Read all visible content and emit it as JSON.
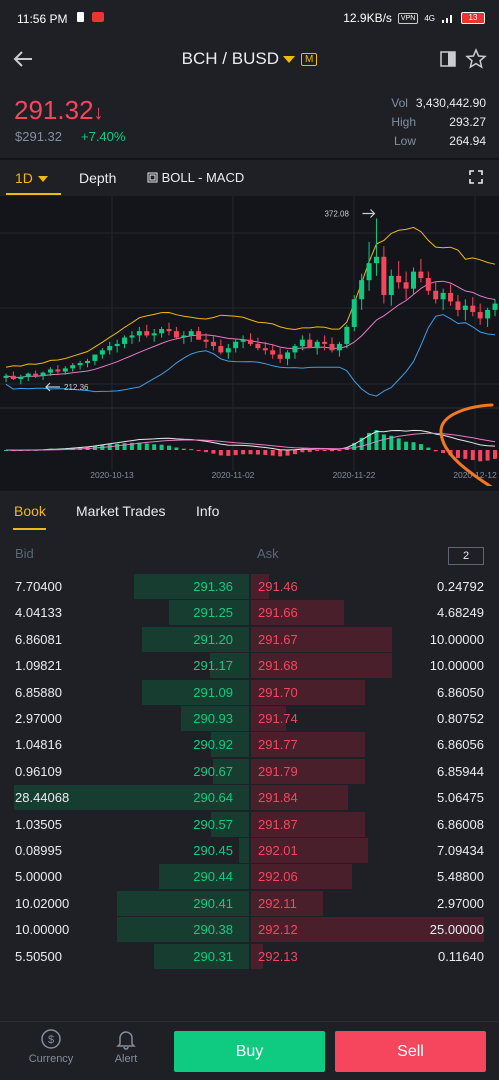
{
  "status_bar": {
    "time": "11:56 PM",
    "net_speed": "12.9KB/s",
    "vpn": "VPN",
    "network": "4G",
    "battery": "13"
  },
  "header": {
    "pair": "BCH / BUSD",
    "margin_badge": "M"
  },
  "ticker": {
    "last_price": "291.32",
    "direction_arrow": "↓",
    "usd_price": "$291.32",
    "change_pct": "+7.40%",
    "vol_label": "Vol",
    "vol": "3,430,442.90",
    "high_label": "High",
    "high": "293.27",
    "low_label": "Low",
    "low": "264.94"
  },
  "chart_tabs": {
    "interval": "1D",
    "depth": "Depth",
    "indicators": "BOLL - MACD"
  },
  "chart_data": {
    "type": "candlestick",
    "interval": "1D",
    "max_marker": "372.08",
    "min_marker": "212.36",
    "x_tick_labels": [
      "2020-10-13",
      "2020-11-02",
      "2020-11-22",
      "2020-12-12"
    ],
    "overlays": [
      "BOLL upper",
      "BOLL middle",
      "BOLL lower"
    ],
    "sub_indicator": "MACD",
    "colors": {
      "up": "#0ecb81",
      "down": "#f6465d",
      "boll_upper": "#f0b90b",
      "boll_mid": "#e879c7",
      "boll_lower": "#3d9ee8"
    },
    "ohlc": [
      [
        222,
        226,
        218,
        224
      ],
      [
        224,
        228,
        220,
        221
      ],
      [
        221,
        225,
        216,
        223
      ],
      [
        223,
        227,
        219,
        226
      ],
      [
        226,
        229,
        222,
        224
      ],
      [
        224,
        228,
        220,
        227
      ],
      [
        227,
        232,
        224,
        230
      ],
      [
        230,
        234,
        226,
        228
      ],
      [
        228,
        233,
        225,
        231
      ],
      [
        231,
        236,
        228,
        234
      ],
      [
        234,
        238,
        230,
        236
      ],
      [
        236,
        240,
        232,
        238
      ],
      [
        238,
        242,
        234,
        244
      ],
      [
        244,
        250,
        240,
        248
      ],
      [
        248,
        256,
        244,
        252
      ],
      [
        252,
        258,
        246,
        254
      ],
      [
        254,
        262,
        250,
        260
      ],
      [
        260,
        266,
        254,
        262
      ],
      [
        262,
        270,
        256,
        266
      ],
      [
        266,
        272,
        260,
        262
      ],
      [
        262,
        268,
        256,
        264
      ],
      [
        264,
        270,
        260,
        268
      ],
      [
        268,
        274,
        262,
        266
      ],
      [
        266,
        270,
        258,
        260
      ],
      [
        260,
        266,
        254,
        262
      ],
      [
        262,
        268,
        256,
        266
      ],
      [
        266,
        270,
        258,
        258
      ],
      [
        258,
        264,
        250,
        256
      ],
      [
        256,
        262,
        248,
        252
      ],
      [
        252,
        258,
        244,
        246
      ],
      [
        246,
        254,
        240,
        250
      ],
      [
        250,
        258,
        246,
        256
      ],
      [
        256,
        262,
        250,
        258
      ],
      [
        258,
        264,
        252,
        254
      ],
      [
        254,
        260,
        248,
        250
      ],
      [
        250,
        256,
        244,
        248
      ],
      [
        248,
        254,
        240,
        244
      ],
      [
        244,
        250,
        236,
        240
      ],
      [
        240,
        248,
        234,
        246
      ],
      [
        246,
        254,
        240,
        252
      ],
      [
        252,
        262,
        248,
        258
      ],
      [
        258,
        264,
        252,
        250
      ],
      [
        250,
        258,
        244,
        256
      ],
      [
        256,
        262,
        248,
        254
      ],
      [
        254,
        260,
        246,
        248
      ],
      [
        248,
        256,
        242,
        254
      ],
      [
        254,
        272,
        250,
        270
      ],
      [
        270,
        300,
        266,
        296
      ],
      [
        296,
        320,
        286,
        314
      ],
      [
        314,
        350,
        304,
        330
      ],
      [
        330,
        372,
        318,
        336
      ],
      [
        336,
        346,
        292,
        300
      ],
      [
        300,
        324,
        290,
        318
      ],
      [
        318,
        332,
        306,
        312
      ],
      [
        312,
        322,
        296,
        306
      ],
      [
        306,
        326,
        300,
        322
      ],
      [
        322,
        334,
        312,
        316
      ],
      [
        316,
        322,
        300,
        304
      ],
      [
        304,
        312,
        292,
        296
      ],
      [
        296,
        306,
        286,
        302
      ],
      [
        302,
        310,
        290,
        294
      ],
      [
        294,
        300,
        280,
        286
      ],
      [
        286,
        296,
        276,
        290
      ],
      [
        290,
        298,
        280,
        284
      ],
      [
        284,
        292,
        272,
        278
      ],
      [
        278,
        288,
        270,
        286
      ],
      [
        286,
        296,
        280,
        292
      ]
    ]
  },
  "book_tabs": [
    "Book",
    "Market Trades",
    "Info"
  ],
  "order_book": {
    "bid_header": "Bid",
    "ask_header": "Ask",
    "precision": "2",
    "rows": [
      {
        "bid_qty": "7.70400",
        "bid_px": "291.36",
        "ask_px": "291.46",
        "ask_qty": "0.24792"
      },
      {
        "bid_qty": "4.04133",
        "bid_px": "291.25",
        "ask_px": "291.66",
        "ask_qty": "4.68249"
      },
      {
        "bid_qty": "6.86081",
        "bid_px": "291.20",
        "ask_px": "291.67",
        "ask_qty": "10.00000"
      },
      {
        "bid_qty": "1.09821",
        "bid_px": "291.17",
        "ask_px": "291.68",
        "ask_qty": "10.00000"
      },
      {
        "bid_qty": "6.85880",
        "bid_px": "291.09",
        "ask_px": "291.70",
        "ask_qty": "6.86050"
      },
      {
        "bid_qty": "2.97000",
        "bid_px": "290.93",
        "ask_px": "291.74",
        "ask_qty": "0.80752"
      },
      {
        "bid_qty": "1.04816",
        "bid_px": "290.92",
        "ask_px": "291.77",
        "ask_qty": "6.86056"
      },
      {
        "bid_qty": "0.96109",
        "bid_px": "290.67",
        "ask_px": "291.79",
        "ask_qty": "6.85944"
      },
      {
        "bid_qty": "28.44068",
        "bid_px": "290.64",
        "ask_px": "291.84",
        "ask_qty": "5.06475"
      },
      {
        "bid_qty": "1.03505",
        "bid_px": "290.57",
        "ask_px": "291.87",
        "ask_qty": "6.86008"
      },
      {
        "bid_qty": "0.08995",
        "bid_px": "290.45",
        "ask_px": "292.01",
        "ask_qty": "7.09434"
      },
      {
        "bid_qty": "5.00000",
        "bid_px": "290.44",
        "ask_px": "292.06",
        "ask_qty": "5.48800"
      },
      {
        "bid_qty": "10.02000",
        "bid_px": "290.41",
        "ask_px": "292.11",
        "ask_qty": "2.97000"
      },
      {
        "bid_qty": "10.00000",
        "bid_px": "290.38",
        "ask_px": "292.12",
        "ask_qty": "25.00000"
      },
      {
        "bid_qty": "5.50500",
        "bid_px": "290.31",
        "ask_px": "292.13",
        "ask_qty": "0.11640"
      }
    ]
  },
  "bottom_bar": {
    "currency": "Currency",
    "alert": "Alert",
    "buy": "Buy",
    "sell": "Sell"
  },
  "annotation": {
    "color": "#f07820",
    "shape": "hand-drawn orange curve"
  }
}
